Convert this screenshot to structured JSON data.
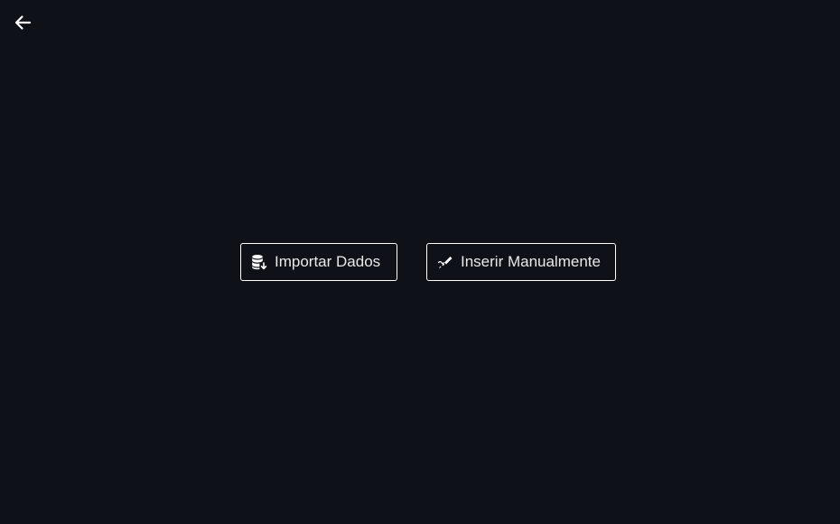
{
  "navigation": {
    "back_icon": "arrow-left-icon"
  },
  "actions": {
    "import": {
      "label": "Importar Dados",
      "icon": "database-download-icon"
    },
    "manual": {
      "label": "Inserir Manualmente",
      "icon": "pen-icon"
    }
  },
  "colors": {
    "background": "#0e1117",
    "foreground": "#ffffff",
    "text": "#e9e9ea"
  }
}
